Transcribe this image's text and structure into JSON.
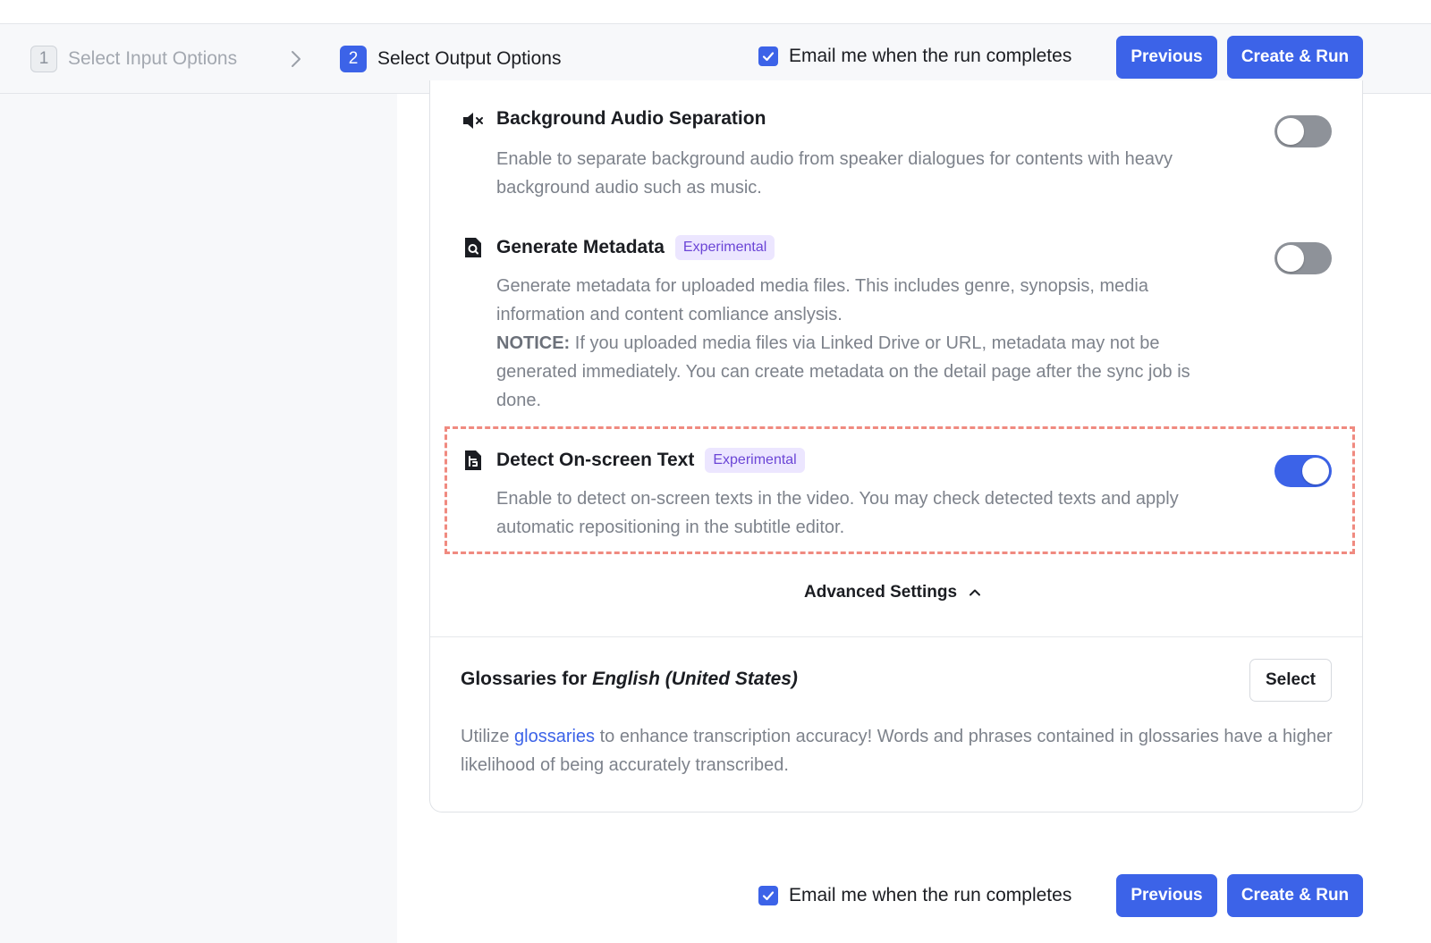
{
  "steps": [
    {
      "number": "1",
      "label": "Select Input Options",
      "state": "inactive"
    },
    {
      "number": "2",
      "label": "Select Output Options",
      "state": "active"
    }
  ],
  "email_notify": {
    "label": "Email me when the run completes",
    "checked": true
  },
  "buttons": {
    "previous": "Previous",
    "create_run": "Create & Run",
    "select": "Select"
  },
  "options": {
    "background_audio": {
      "title": "Background Audio Separation",
      "icon": "mute-speaker-icon",
      "description": "Enable to separate background audio from speaker dialogues for contents with heavy background audio such as music.",
      "enabled": false
    },
    "metadata": {
      "title": "Generate Metadata",
      "icon": "document-search-icon",
      "badge": "Experimental",
      "description": "Generate metadata for uploaded media files. This includes genre, synopsis, media information and content comliance anslysis.",
      "notice_label": "NOTICE:",
      "notice_text": "If you uploaded media files via Linked Drive or URL, metadata may not be generated immediately. You can create metadata on the detail page after the sync job is done.",
      "enabled": false
    },
    "onscreen_text": {
      "title": "Detect On-screen Text",
      "icon": "text-detect-icon",
      "badge": "Experimental",
      "description": "Enable to detect on-screen texts in the video. You may check detected texts and apply automatic repositioning in the subtitle editor.",
      "enabled": true
    }
  },
  "advanced_settings": {
    "label": "Advanced Settings",
    "expanded": true
  },
  "glossary": {
    "title_prefix": "Glossaries for ",
    "language": "English (United States)",
    "desc_prefix": "Utilize ",
    "link_text": "glossaries",
    "desc_suffix": " to enhance transcription accuracy! Words and phrases contained in glossaries have a higher likelihood of being accurately transcribed."
  },
  "colors": {
    "accent": "#3c63e8",
    "highlight": "#f08a80",
    "badge_bg": "#ece6ff",
    "badge_text": "#6b45d6"
  }
}
